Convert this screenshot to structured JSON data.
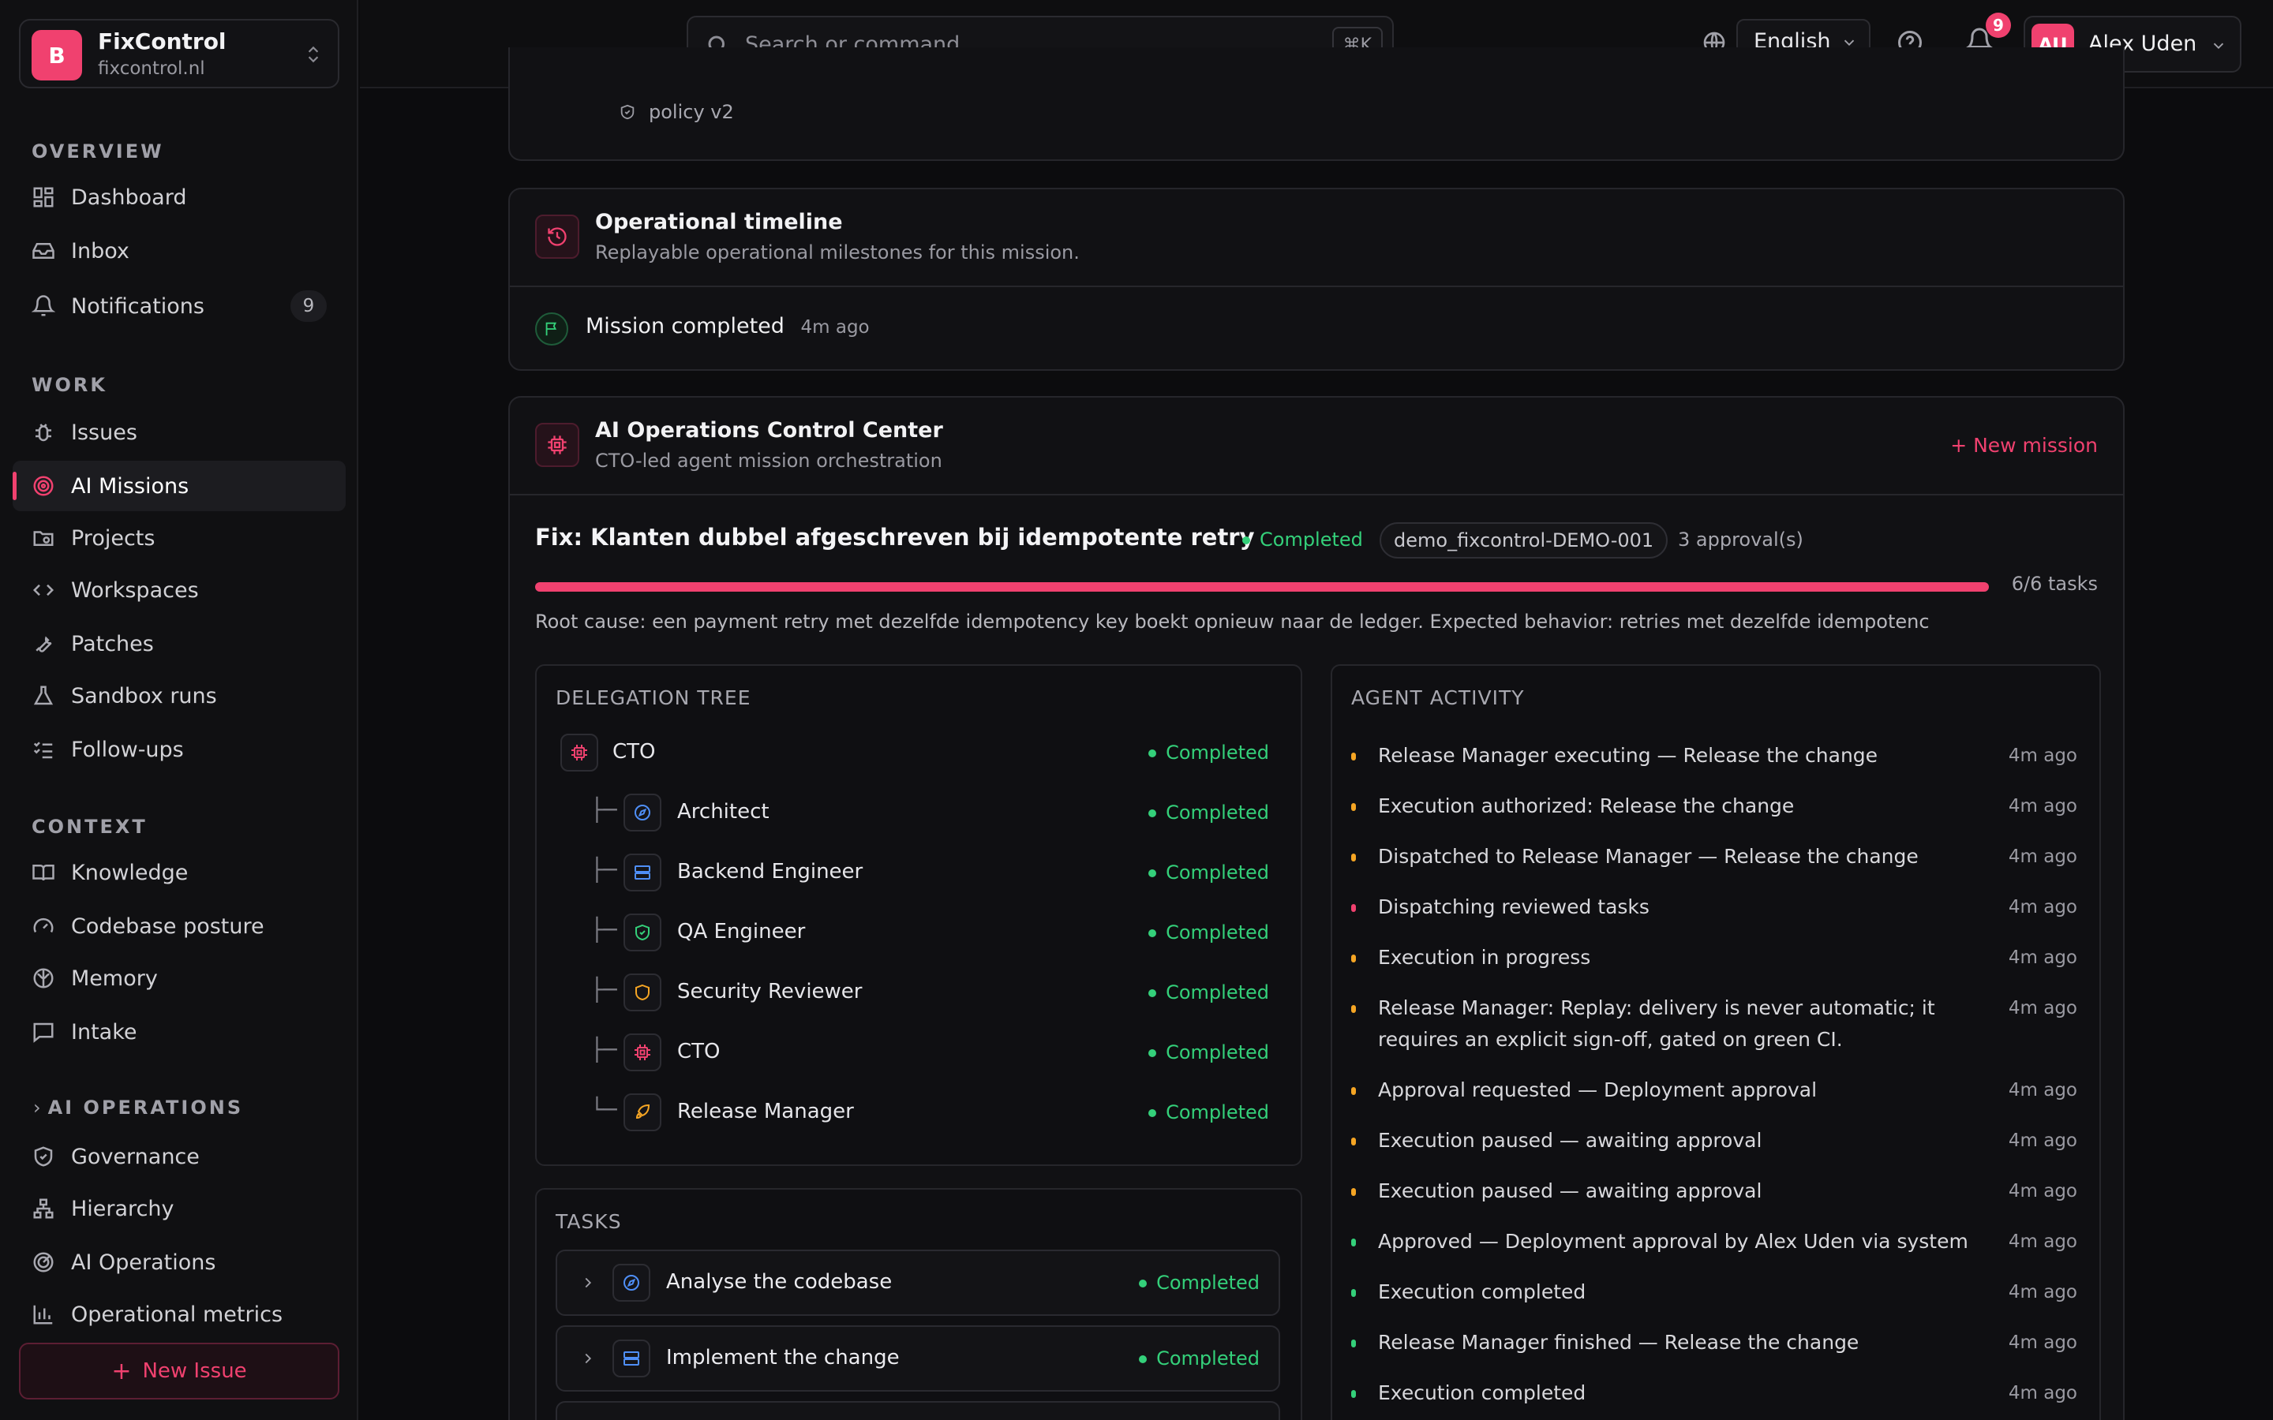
{
  "org": {
    "initial": "B",
    "name": "FixControl",
    "domain": "fixcontrol.nl"
  },
  "sidebar": {
    "sections": {
      "overview": "OVERVIEW",
      "work": "WORK",
      "context": "CONTEXT",
      "ai_operations": "AI OPERATIONS"
    },
    "items": {
      "dashboard": "Dashboard",
      "inbox": "Inbox",
      "notifications": "Notifications",
      "notifications_count": "9",
      "issues": "Issues",
      "ai_missions": "AI Missions",
      "projects": "Projects",
      "workspaces": "Workspaces",
      "patches": "Patches",
      "sandbox_runs": "Sandbox runs",
      "follow_ups": "Follow-ups",
      "knowledge": "Knowledge",
      "codebase_posture": "Codebase posture",
      "memory": "Memory",
      "intake": "Intake",
      "governance": "Governance",
      "hierarchy": "Hierarchy",
      "ai_operations": "AI Operations",
      "operational_metrics": "Operational metrics"
    },
    "new_issue": "New Issue"
  },
  "topbar": {
    "search_placeholder": "Search or command...",
    "shortcut": "⌘K",
    "language": "English",
    "notification_count": "9",
    "user_initials": "AU",
    "user_name": "Alex Uden"
  },
  "policy_card": {
    "policy_label": "policy v2"
  },
  "timeline": {
    "title": "Operational timeline",
    "subtitle": "Replayable operational milestones for this mission.",
    "event": "Mission completed",
    "event_time": "4m ago"
  },
  "control_center": {
    "title": "AI Operations Control Center",
    "subtitle": "CTO-led agent mission orchestration",
    "new_mission": "+ New mission",
    "mission": {
      "title": "Fix: Klanten dubbel afgeschreven bij idempotente retry",
      "status": "Completed",
      "id_tag": "demo_fixcontrol-DEMO-001",
      "approvals": "3 approval(s)",
      "progress": 1.0,
      "progress_label": "6/6 tasks",
      "root_cause": "Root cause: een payment retry met dezelfde idempotency key boekt opnieuw naar de ledger. Expected behavior: retries met dezelfde idempotenc"
    },
    "delegation": {
      "heading": "DELEGATION TREE",
      "root": {
        "name": "CTO",
        "status": "Completed"
      },
      "children": [
        {
          "name": "Architect",
          "status": "Completed",
          "icon": "compass-icon",
          "branch": "├─"
        },
        {
          "name": "Backend Engineer",
          "status": "Completed",
          "icon": "server-icon",
          "branch": "├─"
        },
        {
          "name": "QA Engineer",
          "status": "Completed",
          "icon": "shield-check-icon",
          "branch": "├─"
        },
        {
          "name": "Security Reviewer",
          "status": "Completed",
          "icon": "shield-icon",
          "branch": "├─"
        },
        {
          "name": "CTO",
          "status": "Completed",
          "icon": "cpu-icon",
          "branch": "├─"
        },
        {
          "name": "Release Manager",
          "status": "Completed",
          "icon": "rocket-icon",
          "branch": "└─"
        }
      ]
    },
    "tasks": {
      "heading": "TASKS",
      "items": [
        {
          "name": "Analyse the codebase",
          "status": "Completed"
        },
        {
          "name": "Implement the change",
          "status": "Completed"
        }
      ]
    },
    "activity": {
      "heading": "AGENT ACTIVITY",
      "items": [
        {
          "text": "Release Manager executing — Release the change",
          "time": "4m ago",
          "color": "#f5a524"
        },
        {
          "text": "Execution authorized: Release the change",
          "time": "4m ago",
          "color": "#f5a524"
        },
        {
          "text": "Dispatched to Release Manager — Release the change",
          "time": "4m ago",
          "color": "#f5a524"
        },
        {
          "text": "Dispatching reviewed tasks",
          "time": "4m ago",
          "color": "#f0416f"
        },
        {
          "text": "Execution in progress",
          "time": "4m ago",
          "color": "#f5a524"
        },
        {
          "text": "Release Manager: Replay: delivery is never automatic; it requires an explicit sign-off, gated on green CI.",
          "time": "4m ago",
          "color": "#f5a524"
        },
        {
          "text": "Approval requested — Deployment approval",
          "time": "4m ago",
          "color": "#f5a524"
        },
        {
          "text": "Execution paused — awaiting approval",
          "time": "4m ago",
          "color": "#f5a524"
        },
        {
          "text": "Execution paused — awaiting approval",
          "time": "4m ago",
          "color": "#f5a524"
        },
        {
          "text": "Approved — Deployment approval by Alex Uden via system",
          "time": "4m ago",
          "color": "#34d07a"
        },
        {
          "text": "Execution completed",
          "time": "4m ago",
          "color": "#34d07a"
        },
        {
          "text": "Release Manager finished — Release the change",
          "time": "4m ago",
          "color": "#34d07a"
        },
        {
          "text": "Execution completed",
          "time": "4m ago",
          "color": "#34d07a"
        }
      ]
    }
  },
  "colors": {
    "accent": "#f0416f",
    "success": "#34d07a",
    "warning": "#f5a524"
  }
}
